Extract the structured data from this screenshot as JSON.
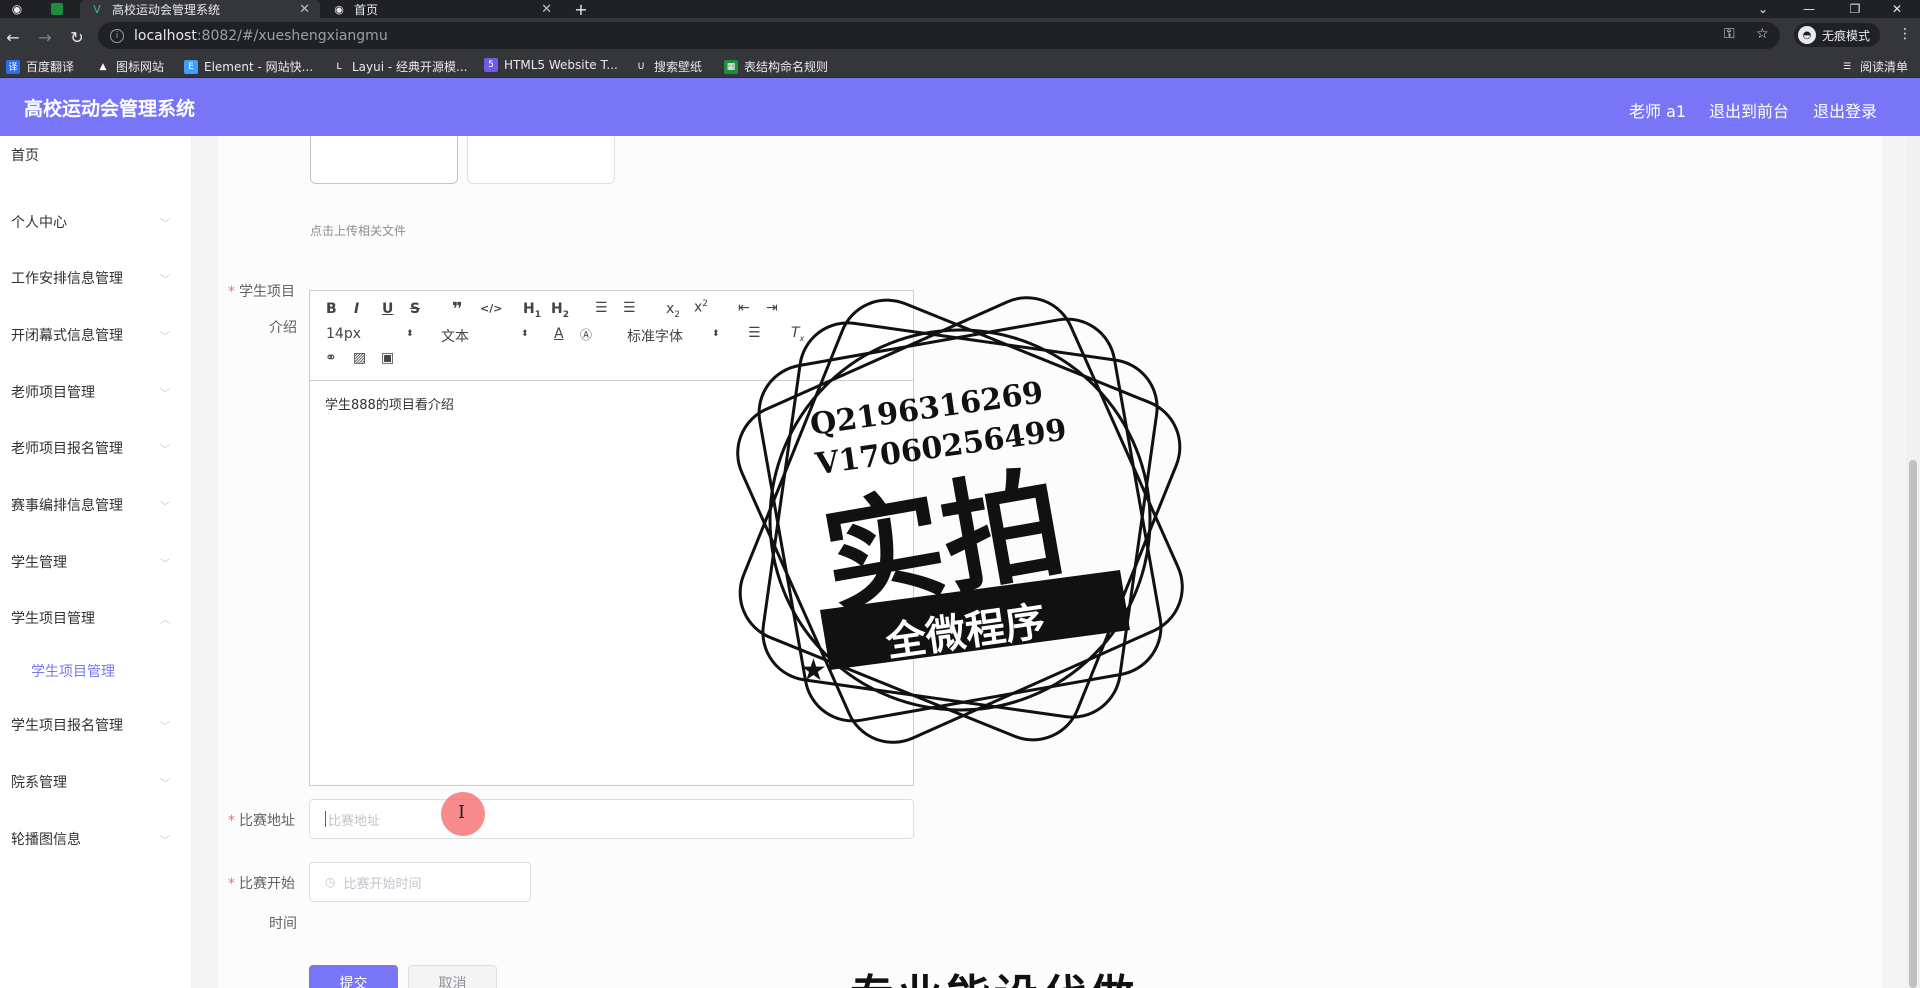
{
  "browser": {
    "tabs": [
      {
        "title": "高校运动会管理系统",
        "active": true
      },
      {
        "title": "首页",
        "active": false
      }
    ],
    "new_tab": "+",
    "url_host": "localhost",
    "url_path": ":8082/#/xueshengxiangmu",
    "profile": "无痕模式",
    "reading_list": "阅读清单",
    "bookmarks": [
      "百度翻译",
      "图标网站",
      "Element - 网站快...",
      "Layui - 经典开源模...",
      "HTML5 Website T...",
      "搜索壁纸",
      "表结构命名规则"
    ]
  },
  "header": {
    "title": "高校运动会管理系统",
    "user": "老师 a1",
    "to_front": "退出到前台",
    "logout": "退出登录",
    "color": "#7876f6"
  },
  "sidebar": {
    "items": [
      {
        "label": "首页"
      },
      {
        "label": "个人中心"
      },
      {
        "label": "工作安排信息管理"
      },
      {
        "label": "开闭幕式信息管理"
      },
      {
        "label": "老师项目管理"
      },
      {
        "label": "老师项目报名管理"
      },
      {
        "label": "赛事编排信息管理"
      },
      {
        "label": "学生管理"
      },
      {
        "label": "学生项目管理"
      },
      {
        "label": "学生项目报名管理"
      },
      {
        "label": "院系管理"
      },
      {
        "label": "轮播图信息"
      }
    ],
    "sub_item": "学生项目管理"
  },
  "form": {
    "upload_hint": "点击上传相关文件",
    "intro_label_1": "学生项目",
    "intro_label_2": "介绍",
    "editor": {
      "font_size": "14px",
      "header": "文本",
      "font": "标准字体",
      "content": "学生888的项目看介绍"
    },
    "address_label": "比赛地址",
    "address_placeholder": "比赛地址",
    "start_label_1": "比赛开始",
    "start_label_2": "时间",
    "start_placeholder": "比赛开始时间",
    "submit": "提交",
    "cancel": "取消"
  },
  "watermark": {
    "qq": "Q2196316269",
    "wx": "V17060256499",
    "big": "实拍",
    "ribbon": "全微程序",
    "bottom": "专业能设代做"
  }
}
